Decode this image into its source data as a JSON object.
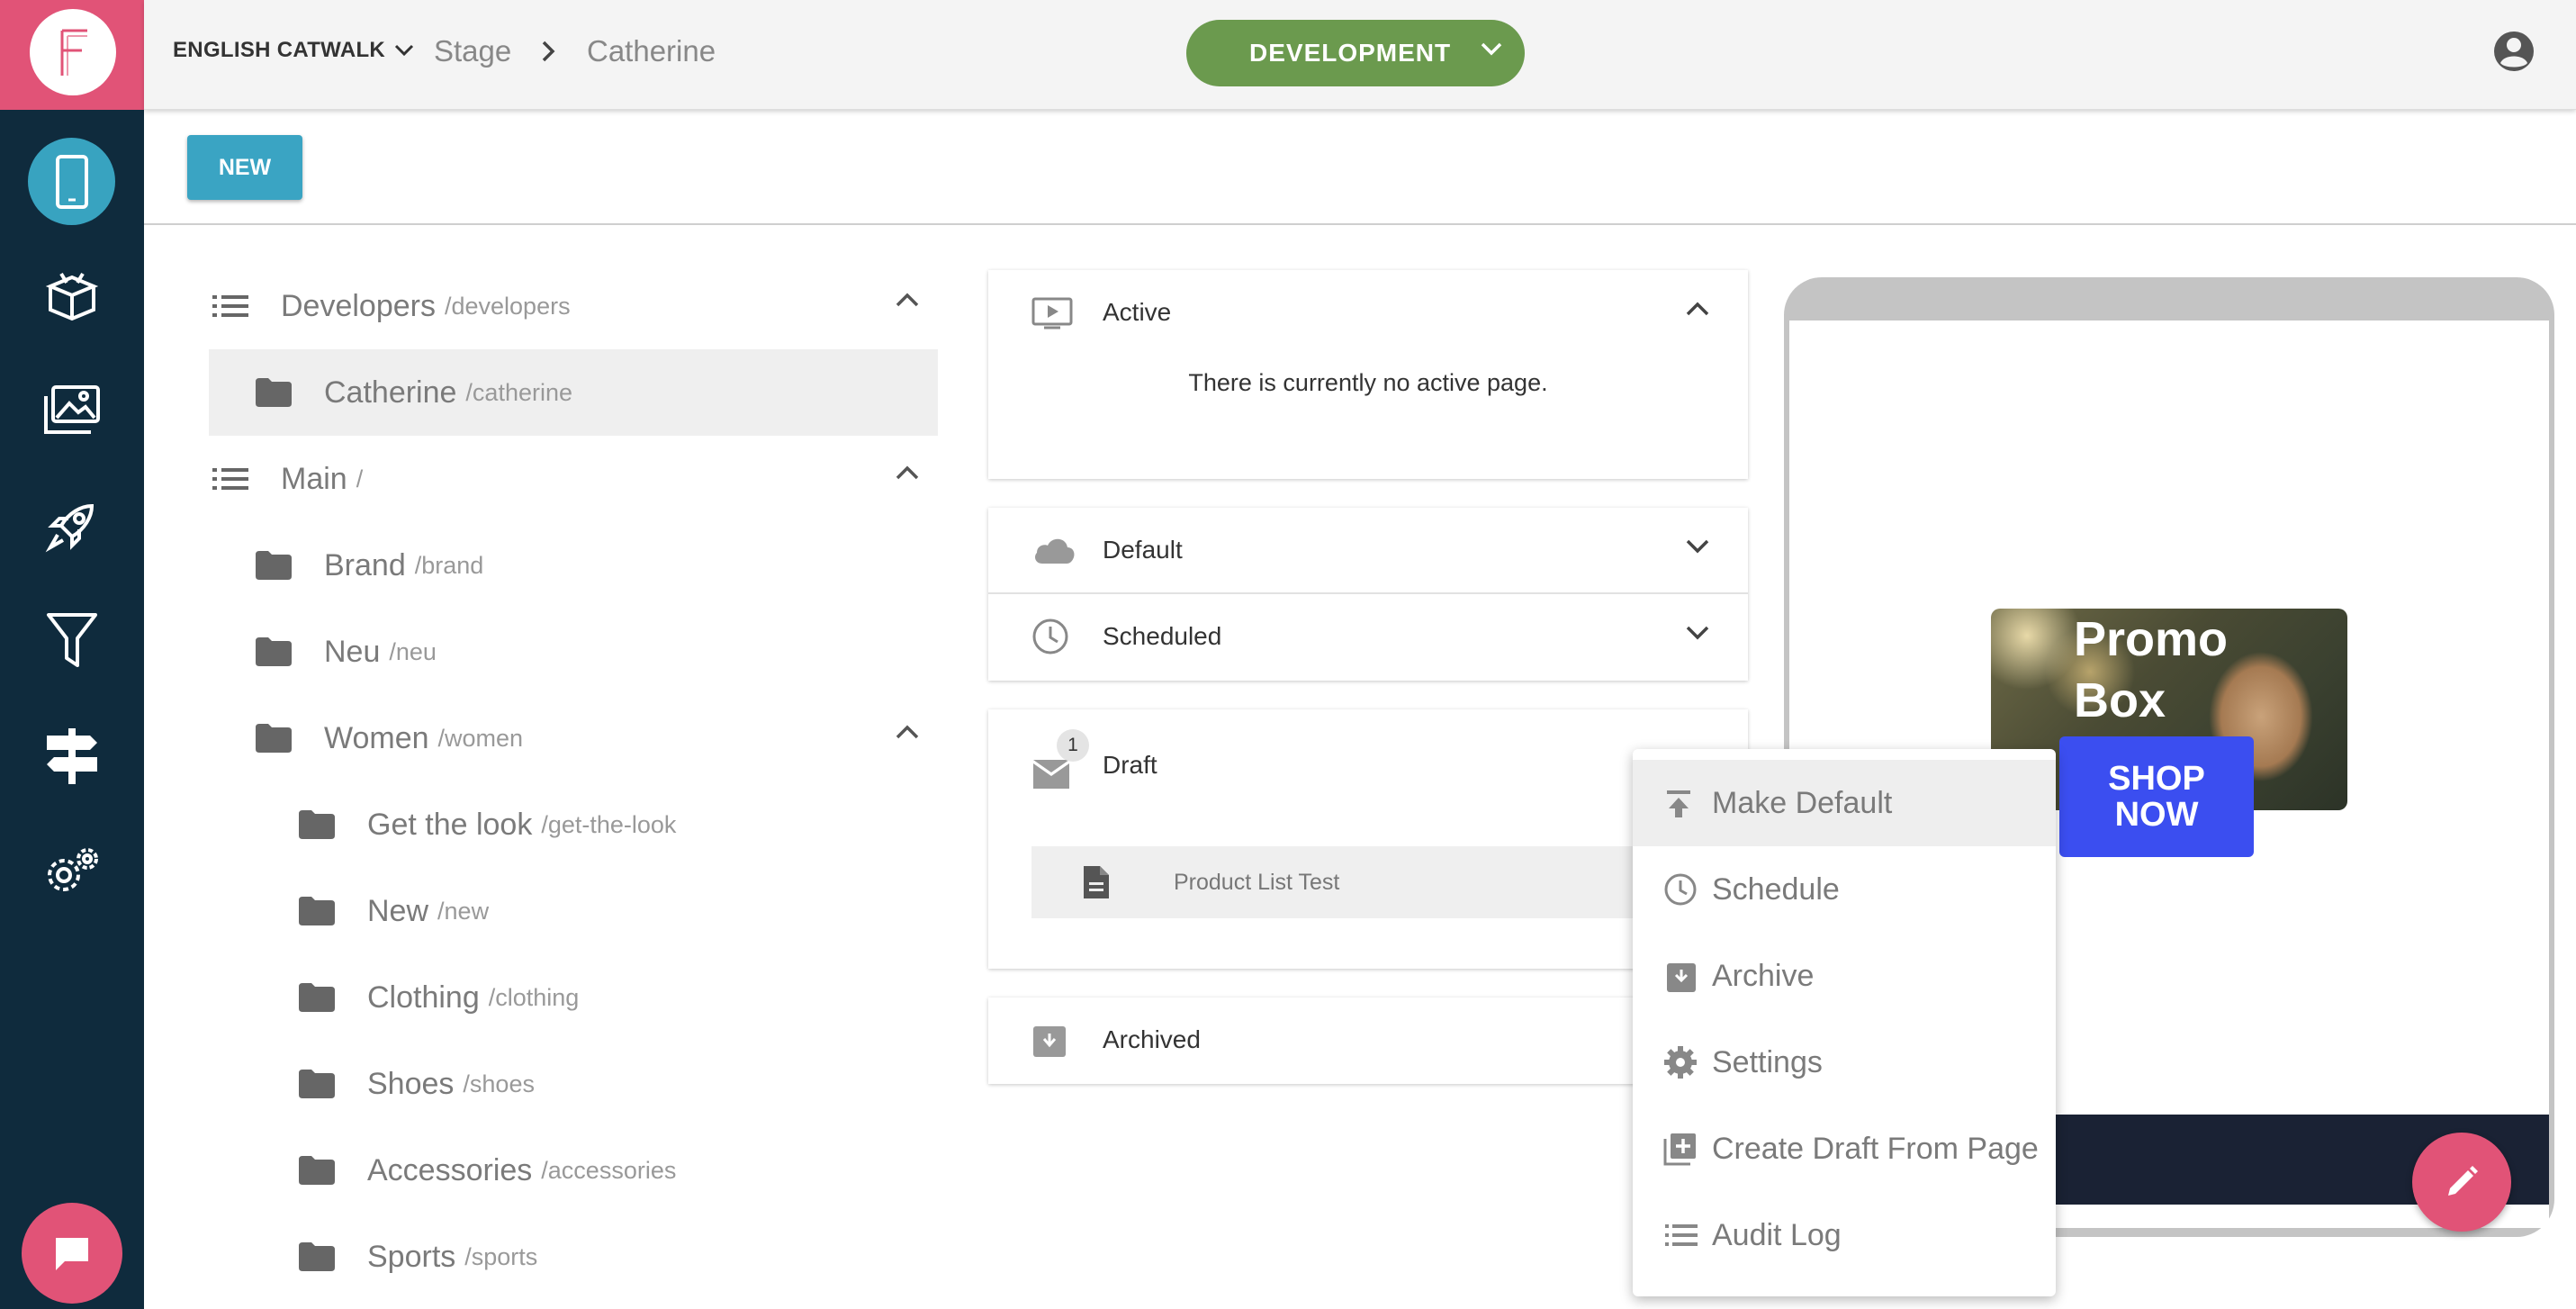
{
  "header": {
    "site": "ENGLISH CATWALK",
    "breadcrumb_stage": "Stage",
    "breadcrumb_page": "Catherine",
    "environment": "DEVELOPMENT"
  },
  "toolbar": {
    "new_label": "NEW"
  },
  "tree": {
    "groups": [
      {
        "name": "Developers",
        "path": "/developers"
      },
      {
        "name": "Main",
        "path": "/"
      }
    ],
    "folders": [
      {
        "name": "Catherine",
        "path": "/catherine"
      },
      {
        "name": "Brand",
        "path": "/brand"
      },
      {
        "name": "Neu",
        "path": "/neu"
      },
      {
        "name": "Women",
        "path": "/women"
      },
      {
        "name": "Get the look",
        "path": "/get-the-look"
      },
      {
        "name": "New",
        "path": "/new"
      },
      {
        "name": "Clothing",
        "path": "/clothing"
      },
      {
        "name": "Shoes",
        "path": "/shoes"
      },
      {
        "name": "Accessories",
        "path": "/accessories"
      },
      {
        "name": "Sports",
        "path": "/sports"
      }
    ]
  },
  "sections": {
    "active": {
      "title": "Active",
      "empty_text": "There is currently no active page."
    },
    "default": {
      "title": "Default"
    },
    "scheduled": {
      "title": "Scheduled"
    },
    "draft": {
      "title": "Draft",
      "badge": "1",
      "item": "Product List Test"
    },
    "archived": {
      "title": "Archived"
    }
  },
  "preview": {
    "promo_title": "Promo Box",
    "shop_line1": "SHOP",
    "shop_line2": "NOW"
  },
  "context_menu": {
    "items": [
      {
        "label": "Make Default",
        "icon": "upload-to-top-icon"
      },
      {
        "label": "Schedule",
        "icon": "clock-icon"
      },
      {
        "label": "Archive",
        "icon": "archive-icon"
      },
      {
        "label": "Settings",
        "icon": "gear-icon"
      },
      {
        "label": "Create Draft From Page",
        "icon": "add-copy-icon"
      },
      {
        "label": "Audit Log",
        "icon": "list-icon"
      }
    ]
  },
  "colors": {
    "rail": "#0f2b3d",
    "brand": "#e15377",
    "accent": "#3aa4c3",
    "environment": "#6b9a4e",
    "shop_button": "#3b4ef0"
  }
}
